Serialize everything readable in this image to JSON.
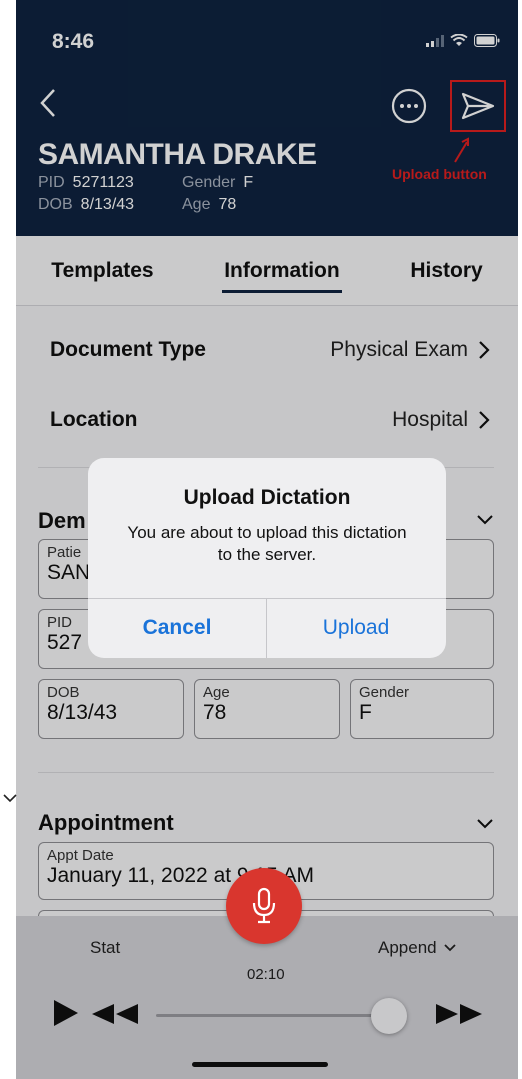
{
  "status_bar": {
    "time": "8:46"
  },
  "patient": {
    "name": "SAMANTHA DRAKE",
    "pid_label": "PID",
    "pid": "5271123",
    "gender_label": "Gender",
    "gender": "F",
    "dob_label": "DOB",
    "dob": "8/13/43",
    "age_label": "Age",
    "age": "78"
  },
  "annotation": {
    "upload_label": "Upload button",
    "color": "#e02020"
  },
  "tabs": [
    {
      "label": "Templates"
    },
    {
      "label": "Information",
      "active": true
    },
    {
      "label": "History"
    }
  ],
  "info": {
    "document_type_label": "Document Type",
    "document_type_value": "Physical Exam",
    "location_label": "Location",
    "location_value": "Hospital"
  },
  "demographics": {
    "title_visible": "Dem",
    "patient_field_label": "Patie",
    "patient_field_value": "SAN",
    "pid_field_label": "PID",
    "pid_field_value": "527",
    "dob_label": "DOB",
    "dob_value": "8/13/43",
    "age_label": "Age",
    "age_value": "78",
    "gender_label": "Gender",
    "gender_value": "F"
  },
  "appointment": {
    "title": "Appointment",
    "appt_date_label": "Appt Date",
    "appt_date_value": "January 11, 2022 at 9:15 AM"
  },
  "player": {
    "stat_label": "Stat",
    "append_label": "Append",
    "timer": "02:10",
    "progress": 0.93
  },
  "dialog": {
    "title": "Upload Dictation",
    "message": "You are about to upload this dictation to the server.",
    "cancel_label": "Cancel",
    "upload_label": "Upload"
  },
  "colors": {
    "header_bg": "#0f2340",
    "mic_red": "#d9362e",
    "link_blue": "#1a73d9"
  }
}
